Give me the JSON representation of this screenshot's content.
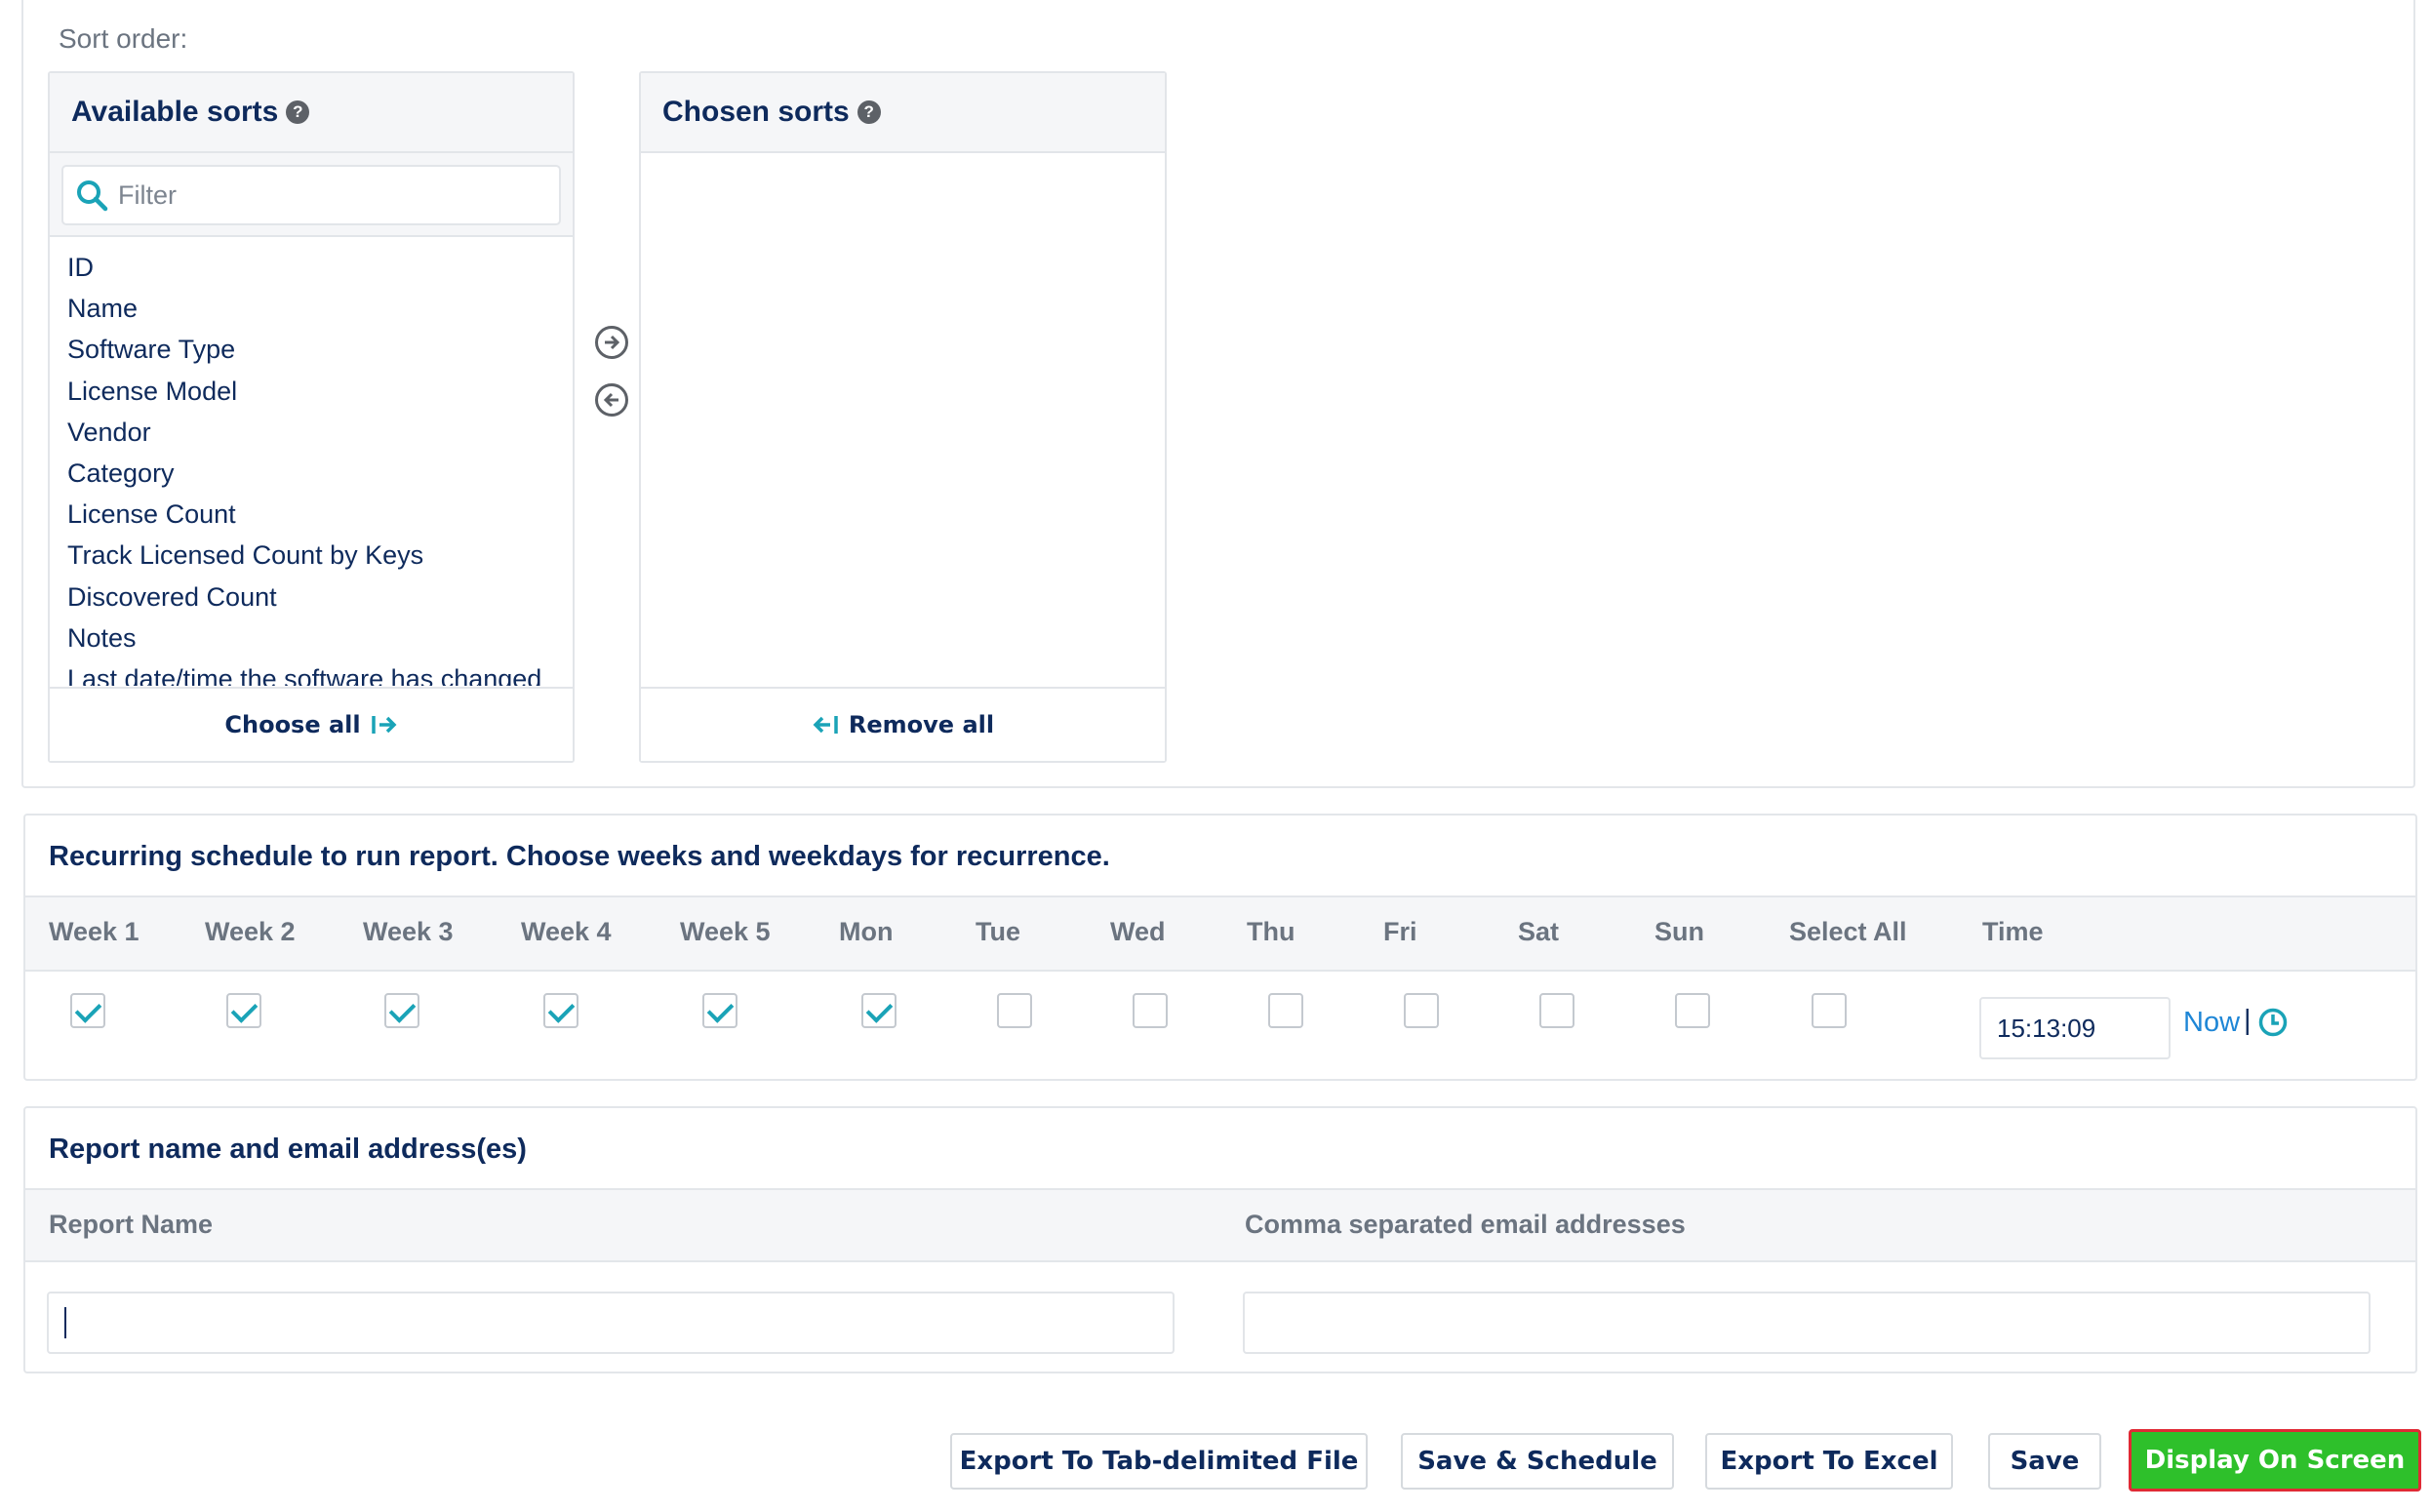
{
  "sort_order": {
    "label": "Sort order:",
    "available": {
      "title": "Available sorts",
      "help": "?",
      "filter_placeholder": "Filter",
      "items": [
        "ID",
        "Name",
        "Software Type",
        "License Model",
        "Vendor",
        "Category",
        "License Count",
        "Track Licensed Count by Keys",
        "Discovered Count",
        "Notes",
        "Last date/time the software has changed"
      ],
      "choose_all_label": "Choose all"
    },
    "chosen": {
      "title": "Chosen sorts",
      "help": "?",
      "remove_all_label": "Remove all"
    },
    "icons": [
      "search-icon",
      "arrow-right-icon",
      "arrow-left-icon",
      "choose-all-icon",
      "remove-all-icon",
      "help-icon"
    ]
  },
  "schedule": {
    "title": "Recurring schedule to run report. Choose weeks and weekdays for recurrence.",
    "columns": [
      "Week 1",
      "Week 2",
      "Week 3",
      "Week 4",
      "Week 5",
      "Mon",
      "Tue",
      "Wed",
      "Thu",
      "Fri",
      "Sat",
      "Sun",
      "Select All",
      "Time"
    ],
    "checked": [
      true,
      true,
      true,
      true,
      true,
      true,
      false,
      false,
      false,
      false,
      false,
      false,
      false
    ],
    "time_value": "15:13:09",
    "now_label": "Now",
    "separator": "|"
  },
  "report": {
    "title": "Report name and email address(es)",
    "name_header": "Report Name",
    "email_header": "Comma separated email addresses",
    "name_value": "",
    "email_value": ""
  },
  "actions": {
    "export_tab": "Export To Tab-delimited File",
    "save_schedule": "Save & Schedule",
    "export_excel": "Export To Excel",
    "save": "Save",
    "display": "Display On Screen"
  },
  "colors": {
    "text": "#0e2a5c",
    "accent": "#1aa3b7",
    "link": "#1e86d6",
    "primary_button": "#2ec02b",
    "highlight_border": "#e02a35"
  }
}
